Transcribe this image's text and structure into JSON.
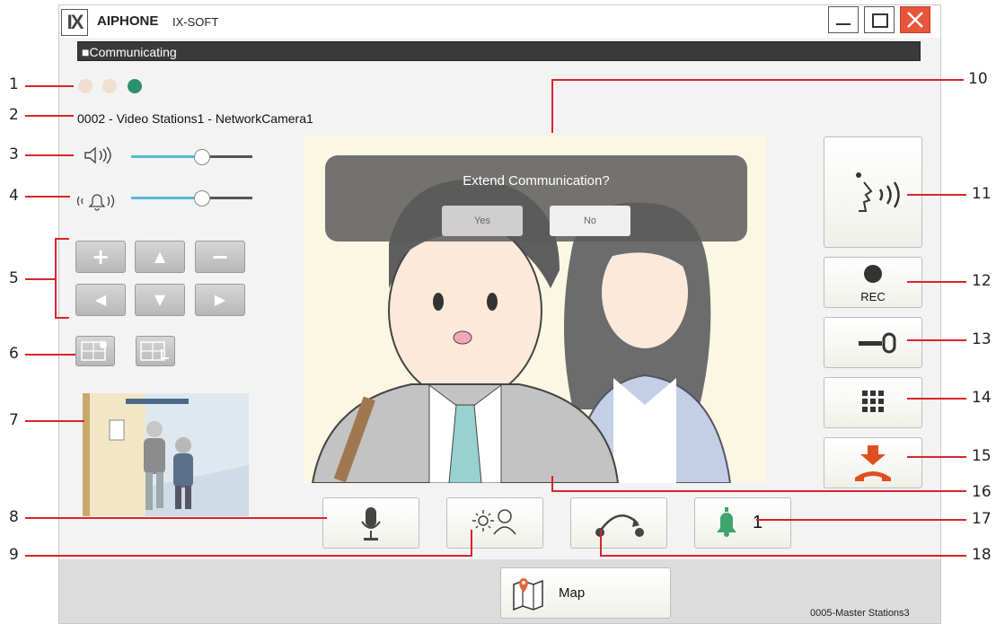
{
  "window": {
    "logo_text": "IX",
    "brand": "AIPHONE",
    "product": "IX-SOFT",
    "controls": [
      "minimize",
      "maximize",
      "close"
    ]
  },
  "status": {
    "text": "■Communicating",
    "indicators": [
      {
        "name": "indicator-1",
        "color": "#f2ddd0"
      },
      {
        "name": "indicator-2",
        "color": "#f1dfcf"
      },
      {
        "name": "indicator-3",
        "color": "#2e8f6e"
      }
    ]
  },
  "station": {
    "name": "0002 - Video Stations1 - NetworkCamera1"
  },
  "volume": {
    "speaker_level": 0.6,
    "ringtone_level": 0.6,
    "accent_color": "#5bb5dd"
  },
  "camera_controls": {
    "zoom_in": "+",
    "zoom_out": "−",
    "up": "▲",
    "down": "▼",
    "left": "◀",
    "right": "▶"
  },
  "dialog": {
    "question": "Extend Communication?",
    "yes_label": "Yes",
    "no_label": "No"
  },
  "bottom_buttons": {
    "notification_count": "1",
    "map_label": "Map"
  },
  "right_buttons": {
    "rec_label": "REC"
  },
  "footer": {
    "station_id": "0005-Master Stations3"
  },
  "callouts": {
    "left": [
      "1",
      "2",
      "3",
      "4",
      "5",
      "6",
      "7",
      "8",
      "9"
    ],
    "right": [
      "10",
      "11",
      "12",
      "13",
      "14",
      "15",
      "16",
      "17",
      "18"
    ]
  },
  "colors": {
    "callout_line": "#d9242a",
    "hangup": "#e04e1f",
    "bell": "#3fa56a"
  }
}
